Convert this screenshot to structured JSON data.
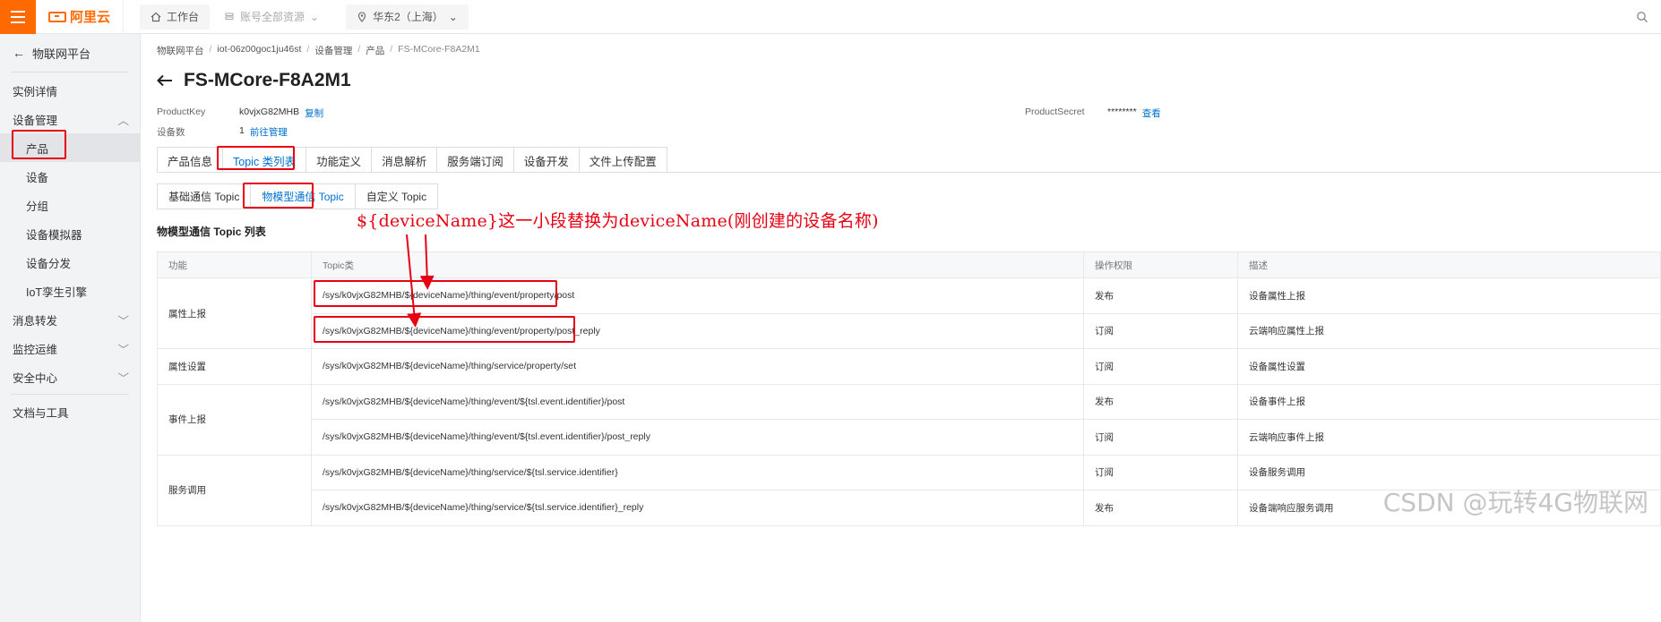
{
  "topbar": {
    "brand": "阿里云",
    "workbench": "工作台",
    "account_resources": "账号全部资源",
    "region": "华东2（上海）"
  },
  "sidebar": {
    "back_label": "物联网平台",
    "items": [
      {
        "label": "实例详情"
      },
      {
        "label": "设备管理"
      },
      {
        "label": "产品"
      },
      {
        "label": "设备"
      },
      {
        "label": "分组"
      },
      {
        "label": "设备模拟器"
      },
      {
        "label": "设备分发"
      },
      {
        "label": "IoT孪生引擎"
      },
      {
        "label": "消息转发"
      },
      {
        "label": "监控运维"
      },
      {
        "label": "安全中心"
      },
      {
        "label": "文档与工具"
      }
    ]
  },
  "breadcrumb": [
    "物联网平台",
    "iot-06z00goc1ju46st",
    "设备管理",
    "产品",
    "FS-MCore-F8A2M1"
  ],
  "page": {
    "title": "FS-MCore-F8A2M1",
    "product_key_label": "ProductKey",
    "product_key_value": "k0vjxG82MHB",
    "copy_link": "复制",
    "device_count_label": "设备数",
    "device_count_value": "1",
    "manage_link": "前往管理",
    "product_secret_label": "ProductSecret",
    "product_secret_value": "********",
    "view_link": "查看"
  },
  "tabs": [
    "产品信息",
    "Topic 类列表",
    "功能定义",
    "消息解析",
    "服务端订阅",
    "设备开发",
    "文件上传配置"
  ],
  "subtabs": [
    "基础通信 Topic",
    "物模型通信 Topic",
    "自定义 Topic"
  ],
  "section_title": "物模型通信 Topic 列表",
  "annotation": "${deviceName}这一小段替换为deviceName(刚创建的设备名称)",
  "table": {
    "headers": [
      "功能",
      "Topic类",
      "操作权限",
      "描述"
    ],
    "groups": [
      {
        "func": "属性上报",
        "rows": [
          {
            "topic": "/sys/k0vjxG82MHB/${deviceName}/thing/event/property/post",
            "perm": "发布",
            "desc": "设备属性上报"
          },
          {
            "topic": "/sys/k0vjxG82MHB/${deviceName}/thing/event/property/post_reply",
            "perm": "订阅",
            "desc": "云端响应属性上报"
          }
        ]
      },
      {
        "func": "属性设置",
        "rows": [
          {
            "topic": "/sys/k0vjxG82MHB/${deviceName}/thing/service/property/set",
            "perm": "订阅",
            "desc": "设备属性设置"
          }
        ]
      },
      {
        "func": "事件上报",
        "rows": [
          {
            "topic": "/sys/k0vjxG82MHB/${deviceName}/thing/event/${tsl.event.identifier}/post",
            "perm": "发布",
            "desc": "设备事件上报"
          },
          {
            "topic": "/sys/k0vjxG82MHB/${deviceName}/thing/event/${tsl.event.identifier}/post_reply",
            "perm": "订阅",
            "desc": "云端响应事件上报"
          }
        ]
      },
      {
        "func": "服务调用",
        "rows": [
          {
            "topic": "/sys/k0vjxG82MHB/${deviceName}/thing/service/${tsl.service.identifier}",
            "perm": "订阅",
            "desc": "设备服务调用"
          },
          {
            "topic": "/sys/k0vjxG82MHB/${deviceName}/thing/service/${tsl.service.identifier}_reply",
            "perm": "发布",
            "desc": "设备端响应服务调用"
          }
        ]
      }
    ]
  },
  "watermark": "CSDN @玩转4G物联网",
  "colors": {
    "brand": "#ff6a00",
    "link": "#0070cc",
    "highlight": "#e60012"
  }
}
